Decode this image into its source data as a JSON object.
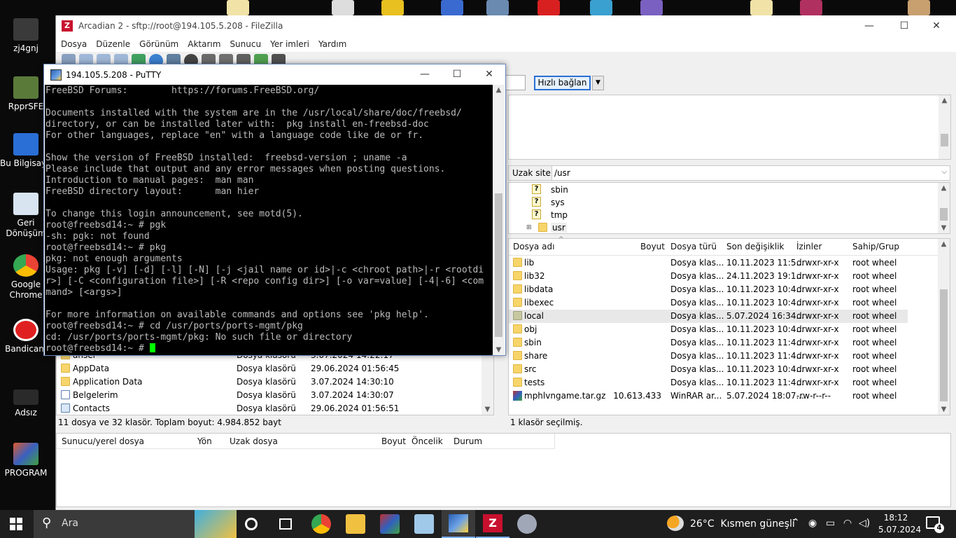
{
  "desktop": {
    "icons": [
      {
        "label": "zj4gnj",
        "color": "#3a3a3a"
      },
      {
        "label": "RpprSFE",
        "color": "#5a7a3a"
      },
      {
        "label": "Bu Bilgisayar",
        "color": "#2a6fd6"
      },
      {
        "label": "Geri Dönüşüm",
        "color": "#d8e4f0"
      },
      {
        "label": "Google Chrome",
        "color": "#4285f4"
      },
      {
        "label": "Bandicam",
        "color": "#e02020"
      },
      {
        "label": "Adsız",
        "color": "#2a2a2a"
      },
      {
        "label": "PROGRAM",
        "color": "#e05a2a"
      }
    ]
  },
  "filezilla": {
    "title": "Arcadian 2 - sftp://root@194.105.5.208 - FileZilla",
    "menu": [
      "Dosya",
      "Düzenle",
      "Görünüm",
      "Aktarım",
      "Sunucu",
      "Yer imleri",
      "Yardım"
    ],
    "quickconnect_label": "Hızlı bağlan",
    "remote_site_label": "Uzak site:",
    "remote_site_value": "/usr",
    "tree": [
      {
        "name": "sbin",
        "icon": "question-folder-icon"
      },
      {
        "name": "sys",
        "icon": "question-folder-icon"
      },
      {
        "name": "tmp",
        "icon": "question-folder-icon"
      },
      {
        "name": "usr",
        "icon": "folder-icon"
      }
    ],
    "remote_headers": [
      "Dosya adı",
      "Boyut",
      "Dosya türü",
      "Son değişiklik",
      "İzinler",
      "Sahip/Grup"
    ],
    "remote_files": [
      {
        "name": "lib",
        "size": "",
        "type": "Dosya klas...",
        "modified": "10.11.2023 11:5...",
        "perms": "drwxr-xr-x",
        "owner": "root wheel"
      },
      {
        "name": "lib32",
        "size": "",
        "type": "Dosya klas...",
        "modified": "24.11.2023 19:1...",
        "perms": "drwxr-xr-x",
        "owner": "root wheel"
      },
      {
        "name": "libdata",
        "size": "",
        "type": "Dosya klas...",
        "modified": "10.11.2023 10:4...",
        "perms": "drwxr-xr-x",
        "owner": "root wheel"
      },
      {
        "name": "libexec",
        "size": "",
        "type": "Dosya klas...",
        "modified": "10.11.2023 10:4...",
        "perms": "drwxr-xr-x",
        "owner": "root wheel"
      },
      {
        "name": "local",
        "size": "",
        "type": "Dosya klas...",
        "modified": "5.07.2024 16:34...",
        "perms": "drwxr-xr-x",
        "owner": "root wheel"
      },
      {
        "name": "obj",
        "size": "",
        "type": "Dosya klas...",
        "modified": "10.11.2023 10:4...",
        "perms": "drwxr-xr-x",
        "owner": "root wheel"
      },
      {
        "name": "sbin",
        "size": "",
        "type": "Dosya klas...",
        "modified": "10.11.2023 11:4...",
        "perms": "drwxr-xr-x",
        "owner": "root wheel"
      },
      {
        "name": "share",
        "size": "",
        "type": "Dosya klas...",
        "modified": "10.11.2023 11:4...",
        "perms": "drwxr-xr-x",
        "owner": "root wheel"
      },
      {
        "name": "src",
        "size": "",
        "type": "Dosya klas...",
        "modified": "10.11.2023 10:4...",
        "perms": "drwxr-xr-x",
        "owner": "root wheel"
      },
      {
        "name": "tests",
        "size": "",
        "type": "Dosya klas...",
        "modified": "10.11.2023 11:4...",
        "perms": "drwxr-xr-x",
        "owner": "root wheel"
      },
      {
        "name": "mphlvngame.tar.gz",
        "size": "10.613.433",
        "type": "WinRAR ar...",
        "modified": "5.07.2024 18:07...",
        "perms": "-rw-r--r--",
        "owner": "root wheel"
      }
    ],
    "remote_status": "1 klasör seçilmiş.",
    "local_files": [
      {
        "name": "ansel",
        "type": "Dosya klasörü",
        "modified": "3.07.2024 14:22:17"
      },
      {
        "name": "AppData",
        "type": "Dosya klasörü",
        "modified": "29.06.2024 01:56:45"
      },
      {
        "name": "Application Data",
        "type": "Dosya klasörü",
        "modified": "3.07.2024 14:30:10"
      },
      {
        "name": "Belgelerim",
        "type": "Dosya klasörü",
        "modified": "3.07.2024 14:30:07"
      },
      {
        "name": "Contacts",
        "type": "Dosya klasörü",
        "modified": "29.06.2024 01:56:51"
      }
    ],
    "local_status": "11 dosya ve 32 klasör. Toplam boyut: 4.984.852 bayt",
    "queue_headers": [
      "Sunucu/yerel dosya",
      "Yön",
      "Uzak dosya",
      "Boyut",
      "Öncelik",
      "Durum"
    ]
  },
  "putty": {
    "title": "194.105.5.208 - PuTTY",
    "lines": [
      "FreeBSD Forums:        https://forums.FreeBSD.org/",
      "",
      "Documents installed with the system are in the /usr/local/share/doc/freebsd/",
      "directory, or can be installed later with:  pkg install en-freebsd-doc",
      "For other languages, replace \"en\" with a language code like de or fr.",
      "",
      "Show the version of FreeBSD installed:  freebsd-version ; uname -a",
      "Please include that output and any error messages when posting questions.",
      "Introduction to manual pages:  man man",
      "FreeBSD directory layout:      man hier",
      "",
      "To change this login announcement, see motd(5).",
      "root@freebsd14:~ # pgk",
      "-sh: pgk: not found",
      "root@freebsd14:~ # pkg",
      "pkg: not enough arguments",
      "Usage: pkg [-v] [-d] [-l] [-N] [-j <jail name or id>|-c <chroot path>|-r <rootdi",
      "r>] [-C <configuration file>] [-R <repo config dir>] [-o var=value] [-4|-6] <com",
      "mand> [<args>]",
      "",
      "For more information on available commands and options see 'pkg help'.",
      "root@freebsd14:~ # cd /usr/ports/ports-mgmt/pkg",
      "cd: /usr/ports/ports-mgmt/pkg: No such file or directory"
    ],
    "prompt": "root@freebsd14:~ # "
  },
  "taskbar": {
    "search_placeholder": "Ara",
    "weather": "26°C  Kısmen güneşli",
    "time": "18:12",
    "date": "5.07.2024",
    "notification_count": "4"
  }
}
